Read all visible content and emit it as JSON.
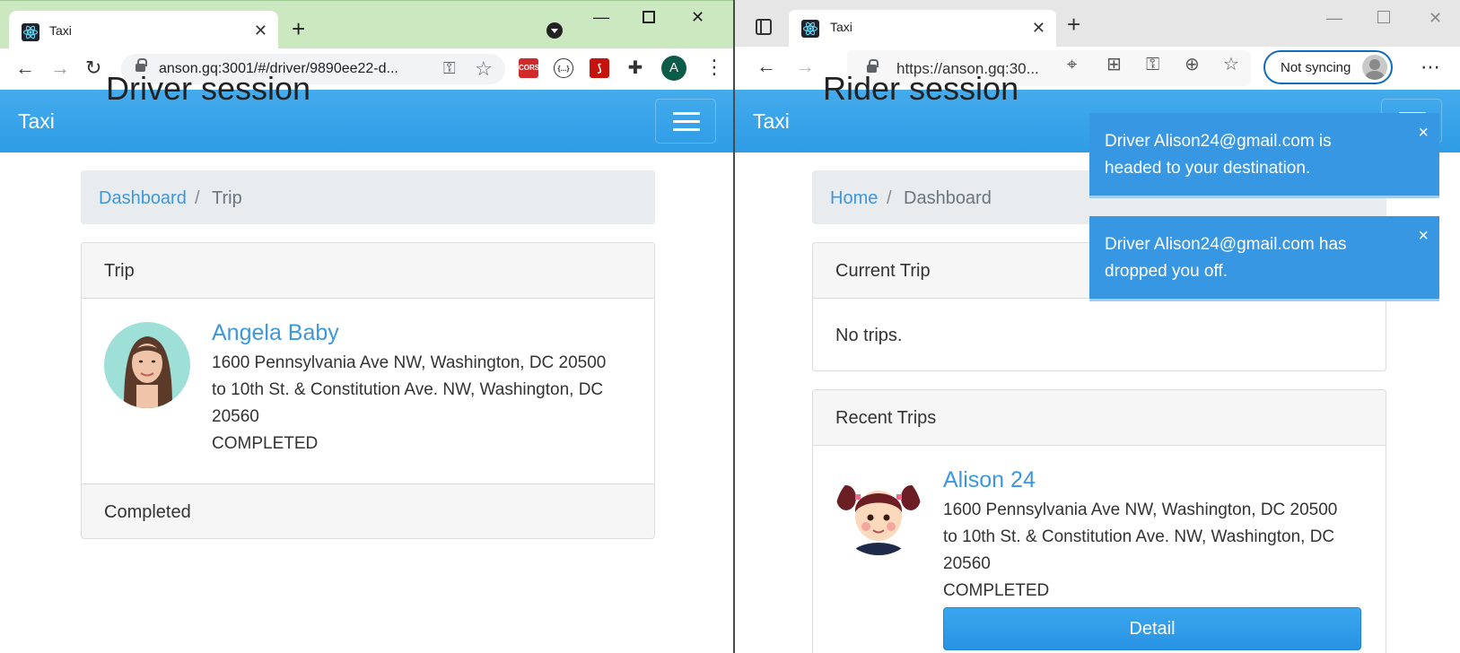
{
  "left_window": {
    "overlay_label": "Driver session",
    "tab": {
      "title": "Taxi"
    },
    "address_bar": {
      "url": "anson.gq:3001/#/driver/9890ee22-d..."
    },
    "extensions": [
      {
        "name": "cors-extension-icon",
        "label": "CORS",
        "color": "#d02b2b"
      },
      {
        "name": "code-extension-icon",
        "label": "{...}",
        "color": "#ffffff"
      },
      {
        "name": "pdf-extension-icon",
        "label": "",
        "color": "#c4120d"
      }
    ],
    "profile_avatar": {
      "initial": "A"
    },
    "navbar": {
      "brand": "Taxi"
    },
    "breadcrumb": {
      "link": "Dashboard",
      "separator": "/",
      "active": "Trip"
    },
    "trip_card": {
      "header": "Trip",
      "rider_name": "Angela Baby",
      "lines": [
        "1600 Pennsylvania Ave NW, Washington, DC 20500",
        "to 10th St. & Constitution Ave. NW, Washington, DC",
        "20560",
        "COMPLETED"
      ],
      "footer": "Completed"
    }
  },
  "right_window": {
    "overlay_label": "Rider session",
    "tab": {
      "title": "Taxi"
    },
    "address_bar": {
      "url": "https://anson.gq:30..."
    },
    "sync_button": {
      "label": "Not syncing"
    },
    "navbar": {
      "brand": "Taxi"
    },
    "breadcrumb": {
      "link": "Home",
      "separator": "/",
      "active": "Dashboard"
    },
    "current_trip_card": {
      "header": "Current Trip",
      "empty_text": "No trips."
    },
    "recent_trips_card": {
      "header": "Recent Trips",
      "driver_name": "Alison 24",
      "lines": [
        "1600 Pennsylvania Ave NW, Washington, DC 20500",
        "to 10th St. & Constitution Ave. NW, Washington, DC",
        "20560",
        "COMPLETED"
      ],
      "detail_button": "Detail"
    },
    "toasts": [
      {
        "message": "Driver Alison24@gmail.com is headed to your destination.",
        "close": "×"
      },
      {
        "message": "Driver Alison24@gmail.com has dropped you off.",
        "close": "×"
      }
    ]
  },
  "colors": {
    "chrome_frame": "#cbe8c0",
    "navbar_blue": "#2e9ce6",
    "link_blue": "#3d97dd",
    "toast_blue": "#3897e3"
  }
}
